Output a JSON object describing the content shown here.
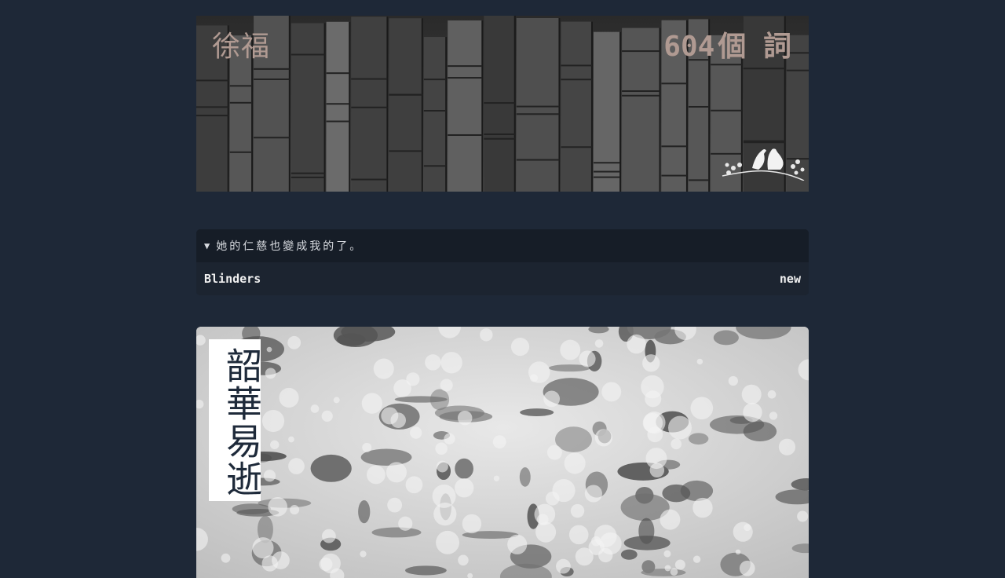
{
  "header": {
    "title": "徐福",
    "word_count": "604",
    "word_count_suffix": "個 詞",
    "title_color": "#b09a92",
    "image": "basalt-columns",
    "emblem": "two-birds-on-branch-icon"
  },
  "entry": {
    "summary": "她的仁慈也變成我的了。",
    "disclosure": "▼",
    "link_label": "Blinders",
    "badge": "new"
  },
  "feature": {
    "vertical_title": "韶華易逝",
    "image": "sea-foam"
  },
  "colors": {
    "background": "#1e2837",
    "card_bg": "#1a222e",
    "summary_bg": "#161d27",
    "text": "#f0f0f0"
  }
}
